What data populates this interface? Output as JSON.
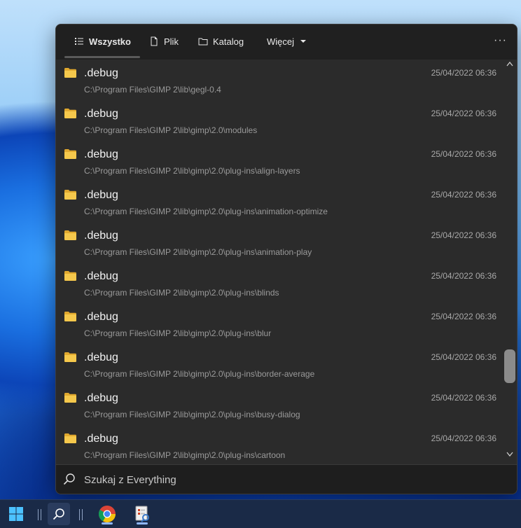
{
  "tabs": [
    {
      "label": "Wszystko",
      "icon": "list-icon",
      "active": true
    },
    {
      "label": "Plik",
      "icon": "file-icon",
      "active": false
    },
    {
      "label": "Katalog",
      "icon": "folder-icon",
      "active": false
    },
    {
      "label": "Więcej",
      "icon": "chevron-down-icon",
      "active": false
    }
  ],
  "more_label": "···",
  "results": [
    {
      "name": ".debug",
      "path": "C:\\Program Files\\GIMP 2\\lib\\gegl-0.4",
      "date": "25/04/2022 06:36"
    },
    {
      "name": ".debug",
      "path": "C:\\Program Files\\GIMP 2\\lib\\gimp\\2.0\\modules",
      "date": "25/04/2022 06:36"
    },
    {
      "name": ".debug",
      "path": "C:\\Program Files\\GIMP 2\\lib\\gimp\\2.0\\plug-ins\\align-layers",
      "date": "25/04/2022 06:36"
    },
    {
      "name": ".debug",
      "path": "C:\\Program Files\\GIMP 2\\lib\\gimp\\2.0\\plug-ins\\animation-optimize",
      "date": "25/04/2022 06:36"
    },
    {
      "name": ".debug",
      "path": "C:\\Program Files\\GIMP 2\\lib\\gimp\\2.0\\plug-ins\\animation-play",
      "date": "25/04/2022 06:36"
    },
    {
      "name": ".debug",
      "path": "C:\\Program Files\\GIMP 2\\lib\\gimp\\2.0\\plug-ins\\blinds",
      "date": "25/04/2022 06:36"
    },
    {
      "name": ".debug",
      "path": "C:\\Program Files\\GIMP 2\\lib\\gimp\\2.0\\plug-ins\\blur",
      "date": "25/04/2022 06:36"
    },
    {
      "name": ".debug",
      "path": "C:\\Program Files\\GIMP 2\\lib\\gimp\\2.0\\plug-ins\\border-average",
      "date": "25/04/2022 06:36"
    },
    {
      "name": ".debug",
      "path": "C:\\Program Files\\GIMP 2\\lib\\gimp\\2.0\\plug-ins\\busy-dialog",
      "date": "25/04/2022 06:36"
    },
    {
      "name": ".debug",
      "path": "C:\\Program Files\\GIMP 2\\lib\\gimp\\2.0\\plug-ins\\cartoon",
      "date": "25/04/2022 06:36"
    }
  ],
  "search": {
    "placeholder": "Szukaj z Everything",
    "value": ""
  },
  "taskbar": {
    "items": [
      "windows-start-icon",
      "search-icon",
      "chrome-icon",
      "everything-app-icon"
    ]
  },
  "colors": {
    "folder": "#f2c14e",
    "panel": "#2b2b2b",
    "tabbar": "#202020",
    "taskbar": "#1a2a47"
  }
}
